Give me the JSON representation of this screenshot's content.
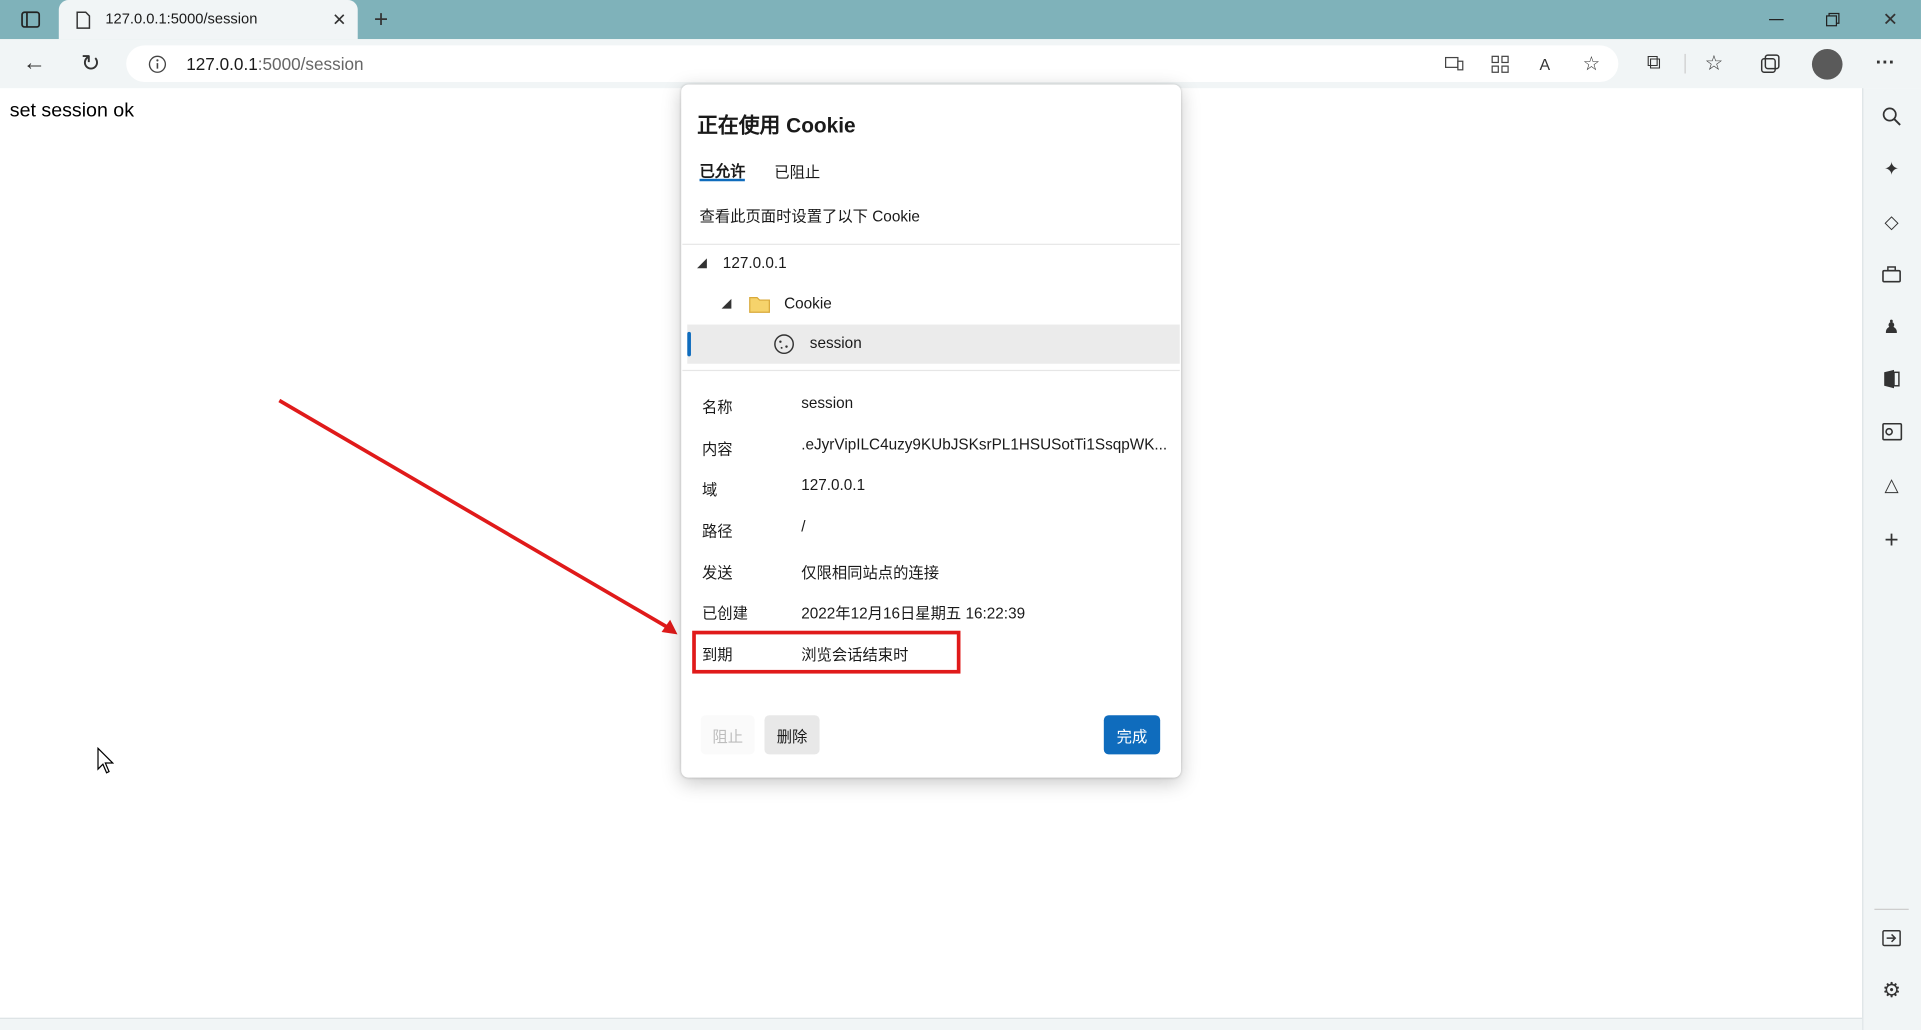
{
  "browser": {
    "tab_title": "127.0.0.1:5000/session",
    "url_host": "127.0.0.1",
    "url_path": ":5000/session",
    "accent_color": "#7fb2ba"
  },
  "page": {
    "text": "set session ok"
  },
  "cookie_dialog": {
    "title": "正在使用 Cookie",
    "tabs": [
      "已允许",
      "已阻止"
    ],
    "description": "查看此页面时设置了以下 Cookie",
    "tree": {
      "host": "127.0.0.1",
      "folder": "Cookie",
      "item": "session"
    },
    "details": {
      "name_label": "名称",
      "name_value": "session",
      "content_label": "内容",
      "content_value": ".eJyrVipILC4uzy9KUbJSKsrPL1HSUSotTi1SsqpWK...",
      "domain_label": "域",
      "domain_value": "127.0.0.1",
      "path_label": "路径",
      "path_value": "/",
      "send_label": "发送",
      "send_value": "仅限相同站点的连接",
      "created_label": "已创建",
      "created_value": "2022年12月16日星期五 16:22:39",
      "expires_label": "到期",
      "expires_value": "浏览会话结束时"
    },
    "buttons": {
      "block": "阻止",
      "delete": "删除",
      "done": "完成"
    },
    "primary_color": "#0f6cbd"
  },
  "annotation_color": "#e01a1a"
}
